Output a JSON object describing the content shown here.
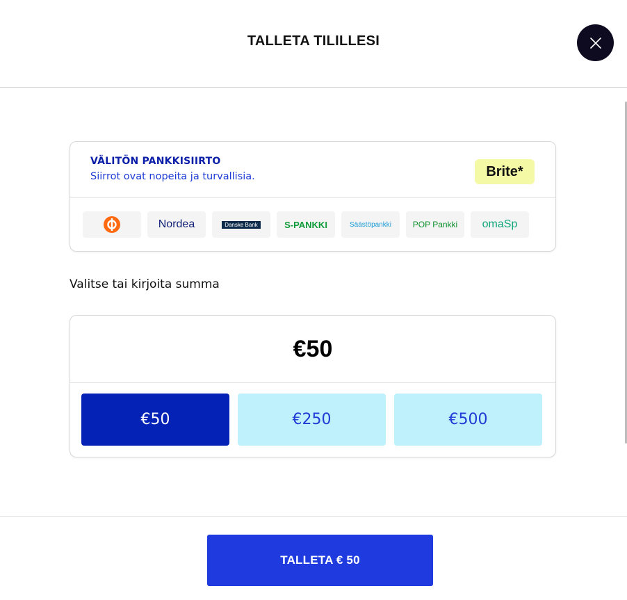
{
  "header": {
    "title": "TALLETA TILILLESI",
    "close_icon": "close-icon"
  },
  "bank_transfer": {
    "title": "VÄLITÖN PANKKISIIRTO",
    "subtitle": "Siirrot ovat nopeita ja turvallisia.",
    "provider_logo": "Brite*",
    "banks": [
      {
        "name": "op-logo"
      },
      {
        "name": "Nordea"
      },
      {
        "name": "Danske Bank"
      },
      {
        "name": "S-PANKKI"
      },
      {
        "name": "Säästöpankki"
      },
      {
        "name": "POP Pankki"
      },
      {
        "name": "omaSp"
      }
    ],
    "colors": {
      "title": "#0a1ea8",
      "subtitle": "#1f3bd6",
      "brite_bg": "#f4f9a6"
    }
  },
  "amount": {
    "label": "Valitse tai kirjoita summa",
    "current": "€50",
    "presets": [
      {
        "label": "€50",
        "selected": true
      },
      {
        "label": "€250",
        "selected": false
      },
      {
        "label": "€500",
        "selected": false
      }
    ],
    "colors": {
      "selected_bg": "#0422b6",
      "preset_bg": "#bff1fc",
      "preset_text": "#1f3bd6"
    }
  },
  "footer": {
    "deposit_label": "TALLETA € 50",
    "button_color": "#1f3be0"
  }
}
